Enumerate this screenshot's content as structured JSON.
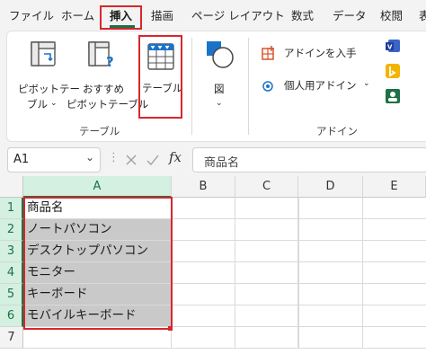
{
  "menu": {
    "tabs": [
      {
        "label": "ファイル"
      },
      {
        "label": "ホーム"
      },
      {
        "label": "挿入"
      },
      {
        "label": "描画"
      },
      {
        "label": "ページ レイアウト"
      },
      {
        "label": "数式"
      },
      {
        "label": "データ"
      },
      {
        "label": "校閲"
      },
      {
        "label": "表"
      }
    ],
    "active_tab": "挿入"
  },
  "ribbon": {
    "tables_group": {
      "pivot_line1": "ピボットテー",
      "pivot_line2": "ブル",
      "recommended_line1": "おすすめ",
      "recommended_line2": "ピボットテーブル",
      "table_label": "テーブル",
      "group_label": "テーブル"
    },
    "illustrations_group": {
      "figure_label": "図"
    },
    "addins_group": {
      "get_addins": "アドインを入手",
      "personal_addins": "個人用アドイン",
      "group_label": "アドイン"
    }
  },
  "formula_bar": {
    "name_box": "A1",
    "fx_symbol": "fx",
    "value": "商品名"
  },
  "sheet": {
    "columns": [
      "A",
      "B",
      "C",
      "D",
      "E"
    ],
    "rows": [
      "1",
      "2",
      "3",
      "4",
      "5",
      "6",
      "7"
    ],
    "cells_a": [
      "商品名",
      "ノートパソコン",
      "デスクトップパソコン",
      "モニター",
      "キーボード",
      "モバイルキーボード",
      ""
    ]
  },
  "colors": {
    "accent": "#1e7145",
    "highlight_box": "#d9262c",
    "selection_fill": "#c9c9c9"
  },
  "icons": [
    "pivot-table-icon",
    "recommended-pivot-icon",
    "table-icon",
    "shapes-icon",
    "store-icon",
    "addins-icon",
    "visio-icon",
    "bing-icon",
    "people-icon",
    "cancel-icon",
    "enter-icon"
  ]
}
